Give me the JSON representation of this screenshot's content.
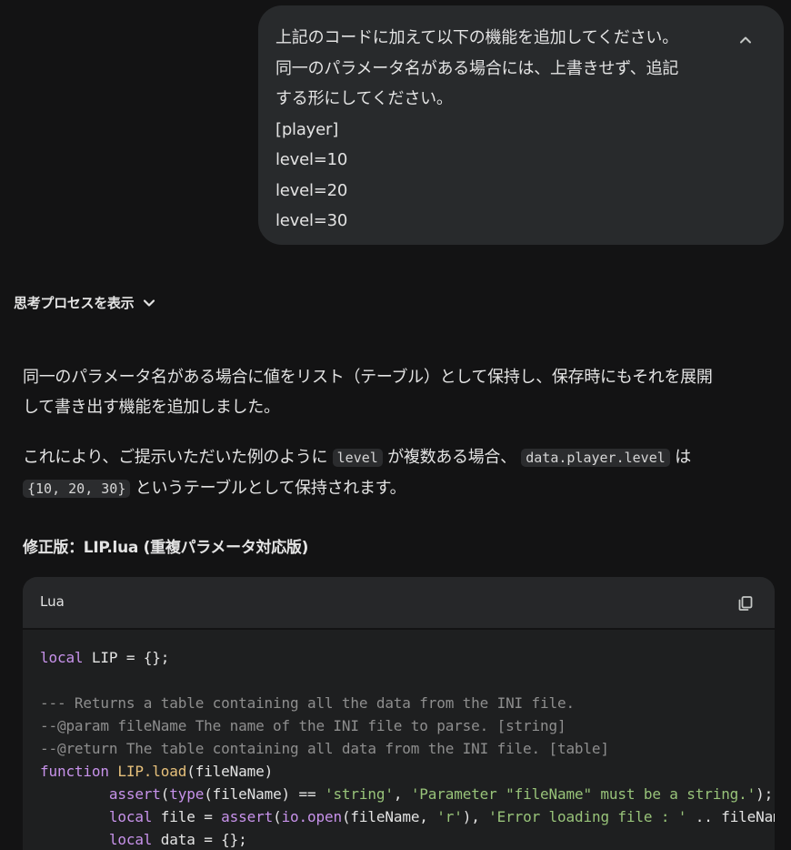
{
  "user_message": {
    "lines": [
      "上記のコードに加えて以下の機能を追加してください。",
      "同一のパラメータ名がある場合には、上書きせず、追記",
      "する形にしてください。",
      "[player]",
      "level=10",
      "level=20",
      "level=30"
    ],
    "collapse_icon": "chevron-up-icon"
  },
  "thinking": {
    "label": "思考プロセスを表示",
    "icon": "chevron-down-icon"
  },
  "response": {
    "para1_line1": "同一のパラメータ名がある場合に値をリスト（テーブル）として保持し、保存時にもそれを展開",
    "para1_line2": "して書き出す機能を追加しました。",
    "para2_a": "これにより、ご提示いただいた例のように",
    "para2_code1": "level",
    "para2_b": "が複数ある場合、",
    "para2_code2": "data.player.level",
    "para2_c": "は",
    "para2_code3": "{10, 20, 30}",
    "para2_d": "というテーブルとして保持されます。",
    "heading": "修正版：LIP.lua (重複パラメータ対応版)"
  },
  "code_block": {
    "language": "Lua",
    "copy_icon": "copy-icon",
    "lines": [
      [
        {
          "t": "local",
          "c": "kw"
        },
        {
          "t": " LIP = {};",
          "c": "plain"
        }
      ],
      [],
      [
        {
          "t": "--- Returns a table containing all the data from the INI file.",
          "c": "cm"
        }
      ],
      [
        {
          "t": "--@param fileName The name of the INI file to parse. [string]",
          "c": "cm"
        }
      ],
      [
        {
          "t": "--@return The table containing all data from the INI file. [table]",
          "c": "cm"
        }
      ],
      [
        {
          "t": "function",
          "c": "kw"
        },
        {
          "t": " ",
          "c": "plain"
        },
        {
          "t": "LIP.load",
          "c": "fn"
        },
        {
          "t": "(fileName)",
          "c": "plain"
        }
      ],
      [
        {
          "t": "        ",
          "c": "plain"
        },
        {
          "t": "assert",
          "c": "bi"
        },
        {
          "t": "(",
          "c": "plain"
        },
        {
          "t": "type",
          "c": "bi"
        },
        {
          "t": "(fileName) == ",
          "c": "plain"
        },
        {
          "t": "'string'",
          "c": "str"
        },
        {
          "t": ", ",
          "c": "plain"
        },
        {
          "t": "'Parameter \"fileName\" must be a string.'",
          "c": "str"
        },
        {
          "t": ");",
          "c": "plain"
        }
      ],
      [
        {
          "t": "        ",
          "c": "plain"
        },
        {
          "t": "local",
          "c": "kw"
        },
        {
          "t": " file = ",
          "c": "plain"
        },
        {
          "t": "assert",
          "c": "bi"
        },
        {
          "t": "(",
          "c": "plain"
        },
        {
          "t": "io.open",
          "c": "bi"
        },
        {
          "t": "(fileName, ",
          "c": "plain"
        },
        {
          "t": "'r'",
          "c": "str"
        },
        {
          "t": "), ",
          "c": "plain"
        },
        {
          "t": "'Error loading file : '",
          "c": "str"
        },
        {
          "t": " .. fileName);",
          "c": "plain"
        }
      ],
      [
        {
          "t": "        ",
          "c": "plain"
        },
        {
          "t": "local",
          "c": "kw"
        },
        {
          "t": " data = {};",
          "c": "plain"
        }
      ]
    ]
  }
}
